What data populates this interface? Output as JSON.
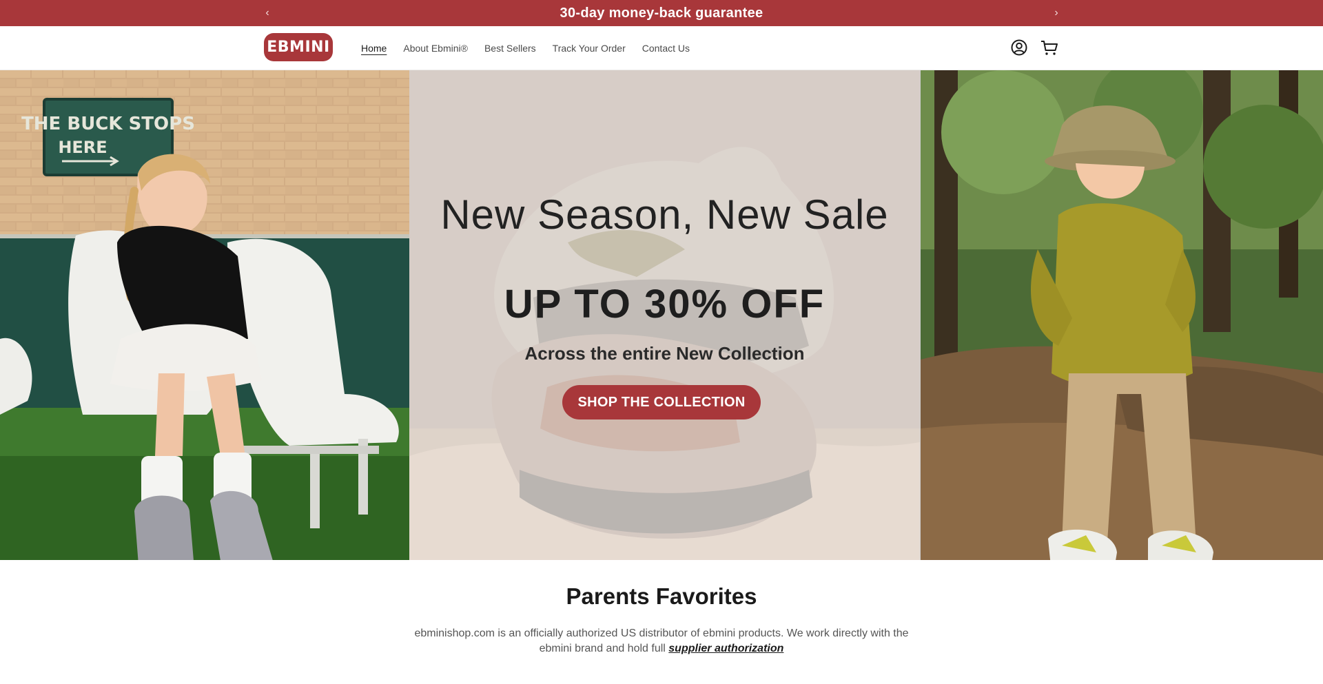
{
  "announcement": {
    "message": "30-day money-back guarantee",
    "prev_icon": "chevron-left-icon",
    "next_icon": "chevron-right-icon",
    "prev_glyph": "‹",
    "next_glyph": "›",
    "background": "#a8373a"
  },
  "header": {
    "logo_text": "EBMINI",
    "nav": [
      {
        "label": "Home",
        "active": true
      },
      {
        "label": "About Ebmini®"
      },
      {
        "label": "Best Sellers"
      },
      {
        "label": "Track Your Order"
      },
      {
        "label": "Contact Us"
      }
    ],
    "icons": [
      "account-icon",
      "cart-icon"
    ]
  },
  "hero": {
    "title": "New Season, New Sale",
    "promo": "UP TO 30% OFF",
    "subtitle": "Across the entire New Collection",
    "cta_label": "SHOP THE COLLECTION",
    "sign_text_line1": "THE BUCK STOPS",
    "sign_text_line2": "HERE"
  },
  "favorites": {
    "title": "Parents Favorites",
    "description": "ebminishop.com is an officially authorized US distributor of ebmini products. We work directly with the ebmini brand and hold full ",
    "link_text": "supplier authorization"
  },
  "colors": {
    "brand": "#a8373a",
    "text": "#1a1a1a"
  }
}
